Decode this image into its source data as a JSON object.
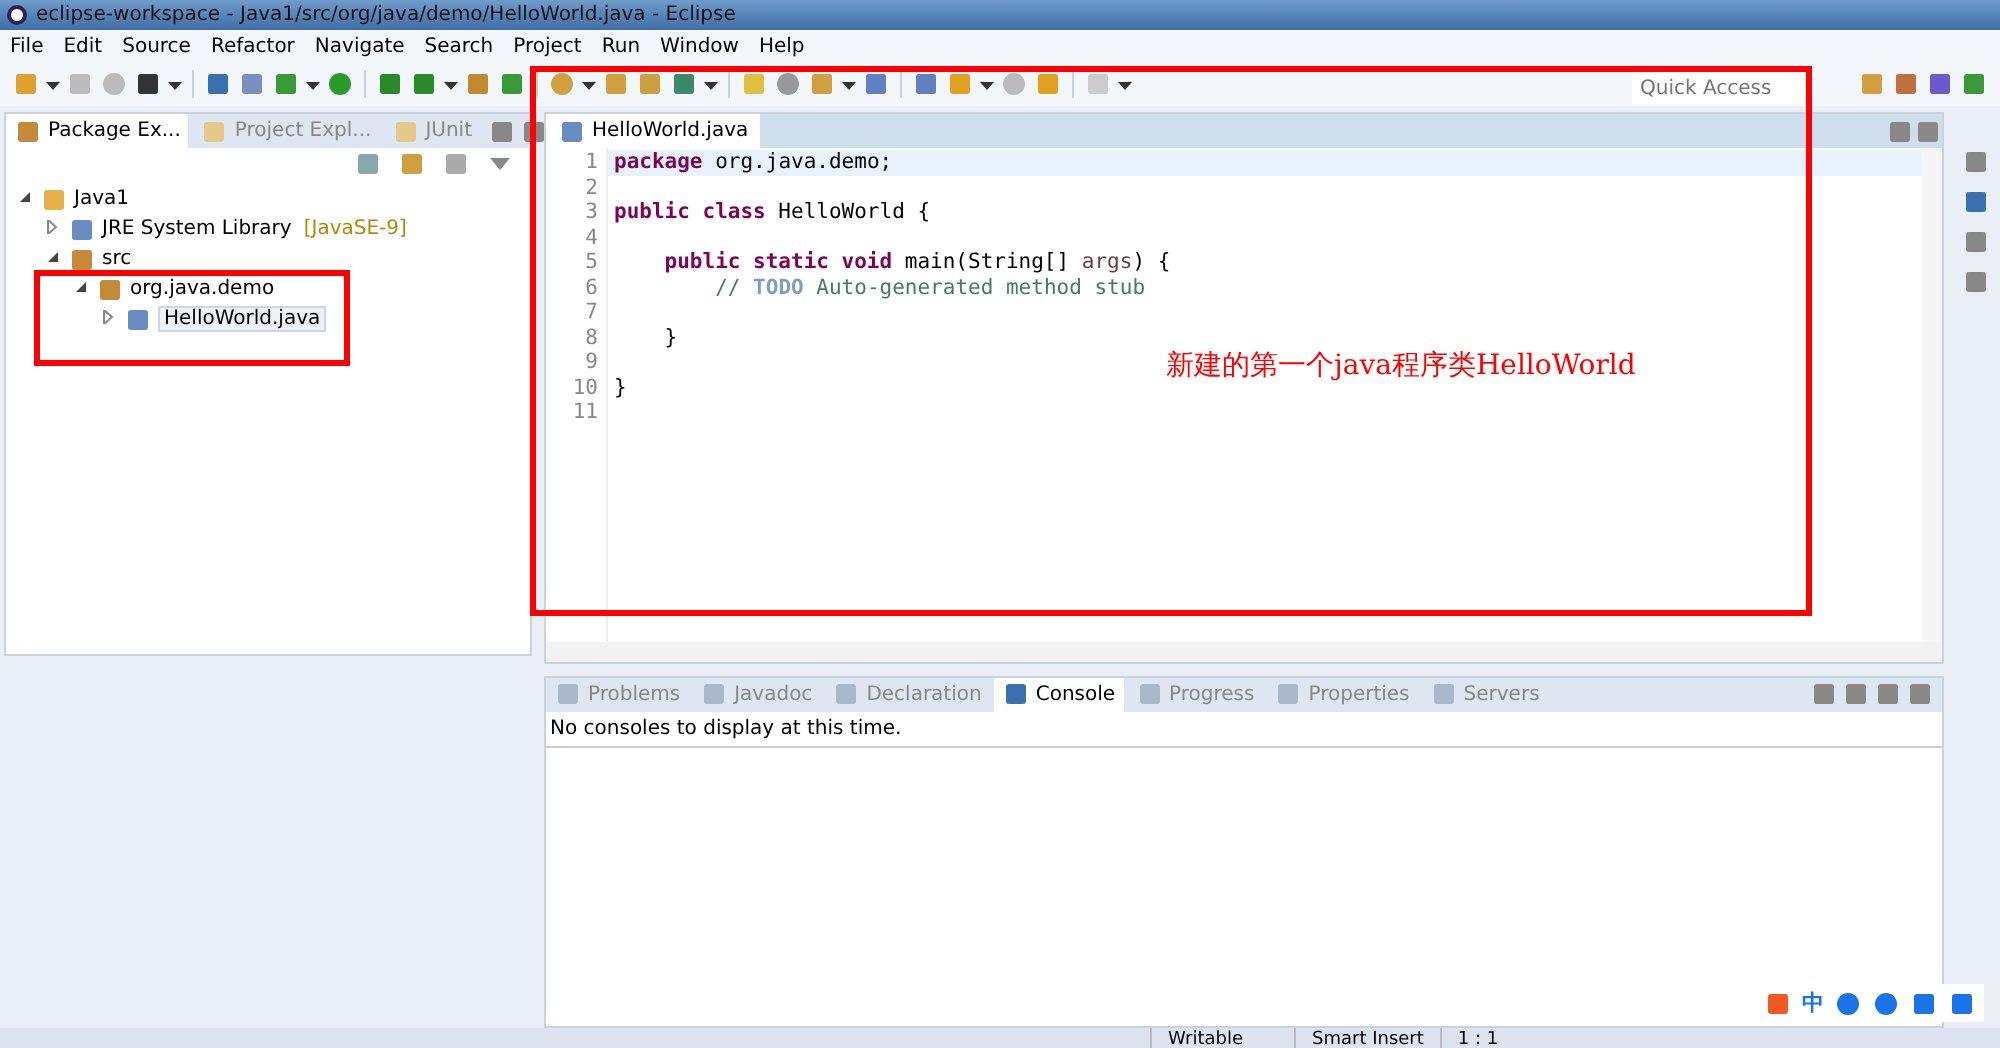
{
  "window": {
    "title": "eclipse-workspace - Java1/src/org/java/demo/HelloWorld.java - Eclipse"
  },
  "menu": [
    "File",
    "Edit",
    "Source",
    "Refactor",
    "Navigate",
    "Search",
    "Project",
    "Run",
    "Window",
    "Help"
  ],
  "quick_access": {
    "placeholder": "Quick Access"
  },
  "left_tabs": [
    {
      "label": "Package Ex...",
      "selected": true
    },
    {
      "label": "Project Expl...",
      "selected": false
    },
    {
      "label": "JUnit",
      "selected": false
    }
  ],
  "tree": [
    {
      "label": "Java1",
      "expanded": true,
      "children": [
        {
          "label": "JRE System Library",
          "decoration": "[JavaSE-9]",
          "expanded": false
        },
        {
          "label": "src",
          "expanded": true,
          "children": [
            {
              "label": "org.java.demo",
              "expanded": true,
              "children": [
                {
                  "label": "HelloWorld.java",
                  "expanded": false,
                  "selected": true
                }
              ]
            }
          ]
        }
      ]
    }
  ],
  "editor": {
    "tab": "HelloWorld.java",
    "lines": [
      {
        "number": "1",
        "tokens": [
          {
            "kind": "keyword",
            "text": "package"
          },
          {
            "kind": "plain",
            "text": " org.java.demo;"
          }
        ]
      },
      {
        "number": "2"
      },
      {
        "number": "3",
        "tokens": [
          {
            "kind": "keyword",
            "text": "public class"
          },
          {
            "kind": "plain",
            "text": " HelloWorld {"
          }
        ]
      },
      {
        "number": "4"
      },
      {
        "number": "5",
        "tokens": [
          {
            "kind": "keyword",
            "text": "    public static void"
          },
          {
            "kind": "plain",
            "text": " main(String[] "
          },
          {
            "kind": "param",
            "text": "args"
          },
          {
            "kind": "plain",
            "text": ") {"
          }
        ]
      },
      {
        "number": "6",
        "tokens": [
          {
            "kind": "comment",
            "text": "        // "
          },
          {
            "kind": "todo",
            "text": "TODO"
          },
          {
            "kind": "comment",
            "text": " Auto-generated method stub"
          }
        ]
      },
      {
        "number": "7"
      },
      {
        "number": "8",
        "tokens": [
          {
            "kind": "plain",
            "text": "    }"
          }
        ]
      },
      {
        "number": "9"
      },
      {
        "number": "10",
        "tokens": [
          {
            "kind": "plain",
            "text": "}"
          }
        ]
      },
      {
        "number": "11"
      }
    ]
  },
  "annotation": "新建的第一个java程序类HelloWorld",
  "bottom_tabs": [
    {
      "label": "Problems",
      "selected": false
    },
    {
      "label": "Javadoc",
      "selected": false
    },
    {
      "label": "Declaration",
      "selected": false
    },
    {
      "label": "Console",
      "selected": true
    },
    {
      "label": "Progress",
      "selected": false
    },
    {
      "label": "Properties",
      "selected": false
    },
    {
      "label": "Servers",
      "selected": false
    }
  ],
  "console_message": "No consoles to display at this time.",
  "ime_bar": {
    "mode": "中"
  },
  "status_bar": [
    "Writable",
    "Smart Insert",
    "1 : 1"
  ]
}
